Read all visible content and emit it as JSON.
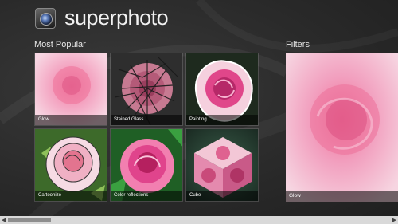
{
  "app": {
    "title": "superphoto",
    "logo_icon": "camera-lens-icon"
  },
  "sections": {
    "popular_label": "Most Popular",
    "filters_label": "Filters"
  },
  "tiles": [
    {
      "label": "Glow"
    },
    {
      "label": "Stained Glass"
    },
    {
      "label": "Painting"
    },
    {
      "label": "Cartoonize"
    },
    {
      "label": "Color reflections"
    },
    {
      "label": "Cube"
    }
  ],
  "preview": {
    "label": "Glow"
  },
  "scrollbar": {
    "left_icon": "arrow-left-icon",
    "right_icon": "arrow-right-icon"
  },
  "colors": {
    "background": "#2a2a2a",
    "rose_pink": "#f080a8",
    "rose_light": "#f7c0d4",
    "scrollbar": "#d9d9d9"
  }
}
